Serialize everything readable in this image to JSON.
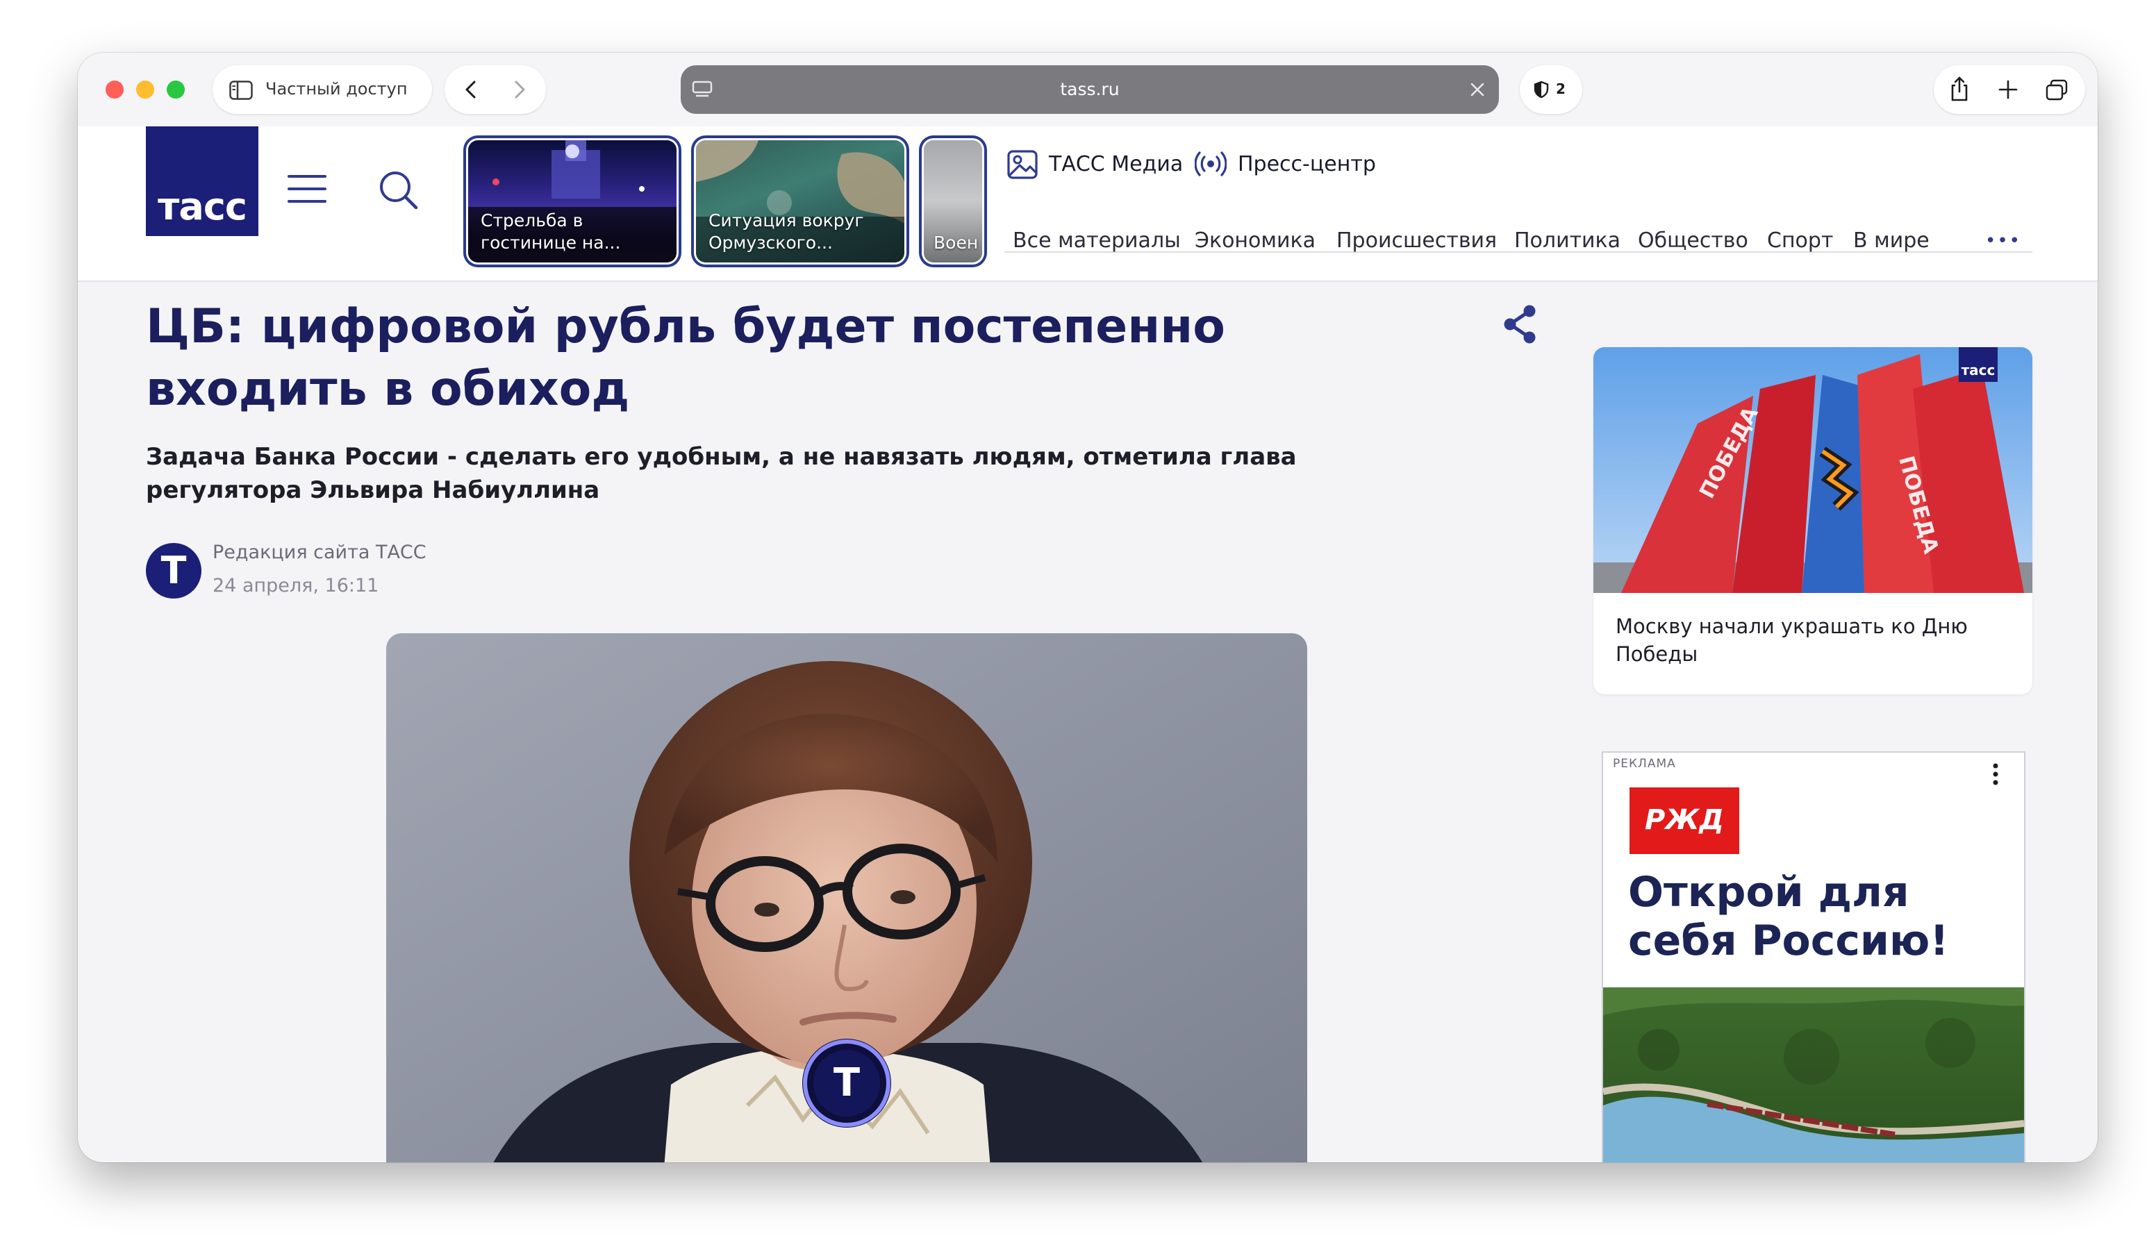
{
  "browser": {
    "private_label": "Частный доступ",
    "url": "tass.ru",
    "shield_count": "2"
  },
  "site": {
    "logo": "тасс",
    "stories": [
      {
        "text": "Стрельба в гостинице на..."
      },
      {
        "text": "Ситуация вокруг Ормузского..."
      },
      {
        "text": "Воен на Ук"
      }
    ],
    "top_links": {
      "media": "ТАСС Медиа",
      "press": "Пресс-центр"
    },
    "nav": [
      "Все материалы",
      "Экономика",
      "Происшествия",
      "Политика",
      "Общество",
      "Спорт",
      "В мире"
    ],
    "more": "•••"
  },
  "article": {
    "headline": "ЦБ: цифровой рубль будет постепенно входить в обиход",
    "lead": "Задача Банка России - сделать его удобным, а не навязать людям, отметила глава регулятора Эльвира Набиуллина",
    "author": "Редакция сайта ТАСС",
    "date": "24 апреля, 16:11",
    "avatar_letter": "Т",
    "photo_badge_letter": "Т"
  },
  "sidebar": {
    "card_badge": "тасс",
    "card_text": "Москву начали украшать ко Дню Победы",
    "flag_text_1": "ПОБЕДА",
    "flag_text_2": "ПОБЕДА",
    "ad_label": "РЕКЛАМА",
    "ad_logo": "РЖД",
    "ad_headline": "Открой для себя Россию!"
  },
  "colors": {
    "brand_navy": "#1b1f77",
    "headline": "#1b1f5e",
    "ad_red": "#e21a1a"
  }
}
